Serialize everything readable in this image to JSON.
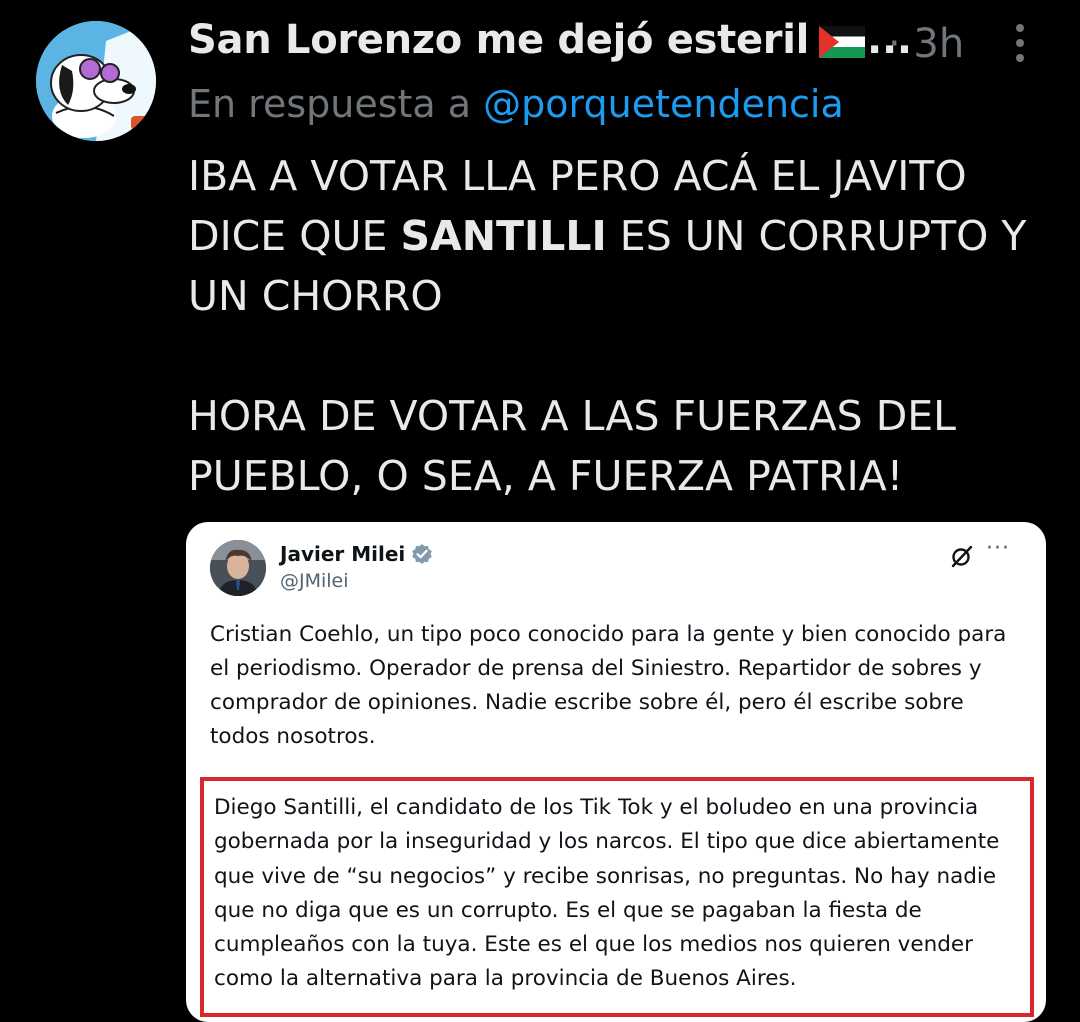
{
  "post": {
    "author_name": "San Lorenzo me dejó esteril",
    "author_name_ellipsis": "...",
    "time": "· 3h",
    "reply_prefix": "En respuesta a",
    "reply_handle": "@porquetendencia",
    "text": {
      "line1": "IBA A VOTAR LLA PERO ACÁ EL JAVITO",
      "line2_pre": "DICE QUE ",
      "line2_bold": "SANTILLI",
      "line2_post": " ES UN CORRUPTO Y",
      "line3": "UN CHORRO",
      "line4": "HORA DE VOTAR A LAS FUERZAS DEL",
      "line5": "PUEBLO, O SEA, A FUERZA PATRIA!"
    }
  },
  "quoted": {
    "name": "Javier Milei",
    "handle": "@JMilei",
    "more": "···",
    "paragraph1": "Cristian Coehlo, un tipo poco conocido para la gente y bien conocido para el periodismo. Operador de prensa del Siniestro. Repartidor de sobres y comprador de opiniones. Nadie escribe sobre él, pero él escribe sobre todos nosotros.",
    "paragraph2": "Diego Santilli, el candidato de los Tik Tok y el boludeo en una provincia gobernada por la inseguridad y los narcos. El tipo que dice abiertamente que vive de “su negocios” y recibe sonrisas, no preguntas. No hay nadie que no diga que es un corrupto. Es el que se pagaban la fiesta de cumpleaños con la tuya. Este es el que los medios nos quieren vender como la alternativa para la provincia de Buenos Aires."
  },
  "icons": {
    "avatar": "snoopy-avatar-icon",
    "flag": "palestine-flag-icon",
    "more": "more-vertical-icon",
    "verified": "verified-badge-icon",
    "grok": "grok-icon"
  },
  "colors": {
    "background": "#000000",
    "text": "#e7e9ea",
    "muted": "#71767b",
    "link": "#1d9bf0",
    "highlight_border": "#d9272e"
  }
}
